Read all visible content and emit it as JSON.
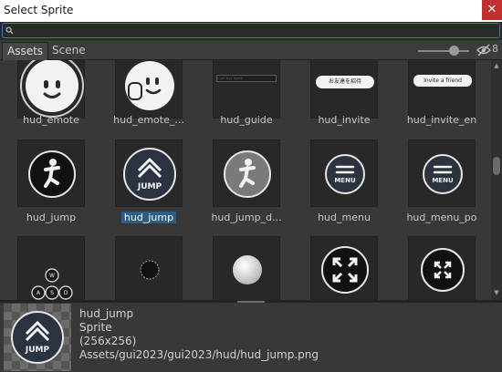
{
  "window": {
    "title": "Select Sprite",
    "close_symbol": "✕"
  },
  "search": {
    "value": "",
    "placeholder": ""
  },
  "tabs": [
    {
      "label": "Assets",
      "active": true
    },
    {
      "label": "Scene",
      "active": false
    }
  ],
  "toolbar": {
    "hidden_count": "8",
    "zoom_slider_value": 0.7
  },
  "grid": [
    {
      "label": "hud_emote",
      "icon": "smiley-face-icon"
    },
    {
      "label": "hud_emote_...",
      "icon": "waving-smiley-icon"
    },
    {
      "label": "hud_guide",
      "icon": "guide-bar-icon"
    },
    {
      "label": "hud_invite",
      "icon": "invite-button-icon"
    },
    {
      "label": "hud_invite_en",
      "icon": "invite-button-en-icon"
    },
    {
      "label": "hud_jump",
      "icon": "jump-figure-icon"
    },
    {
      "label": "hud_jump",
      "icon": "jump-chevron-icon",
      "selected": true
    },
    {
      "label": "hud_jump_d...",
      "icon": "jump-figure-disabled-icon"
    },
    {
      "label": "hud_menu",
      "icon": "menu-icon"
    },
    {
      "label": "hud_menu_po",
      "icon": "menu-pressed-icon"
    },
    {
      "label": "",
      "icon": "wasd-keys-icon"
    },
    {
      "label": "",
      "icon": "joystick-dot-icon"
    },
    {
      "label": "",
      "icon": "white-ball-icon"
    },
    {
      "label": "",
      "icon": "fullscreen-expand-icon"
    },
    {
      "label": "",
      "icon": "fullscreen-expand-small-icon"
    }
  ],
  "thumb_text": {
    "jump": "JUMP",
    "menu": "MENU",
    "guide": "ｼﾞｬﾝﾌﾟ ｶﾞｲﾄﾞ ｾｯﾄｱｯﾌﾟ",
    "invite": "お友達を招待",
    "invite_en": "Invite a friend",
    "wasd": [
      "W",
      "A",
      "S",
      "D"
    ]
  },
  "preview": {
    "name": "hud_jump",
    "type": "Sprite",
    "size": "(256x256)",
    "path": "Assets/gui2023/gui2023/hud/hud_jump.png",
    "icon": "jump-chevron-icon",
    "label": "JUMP"
  }
}
